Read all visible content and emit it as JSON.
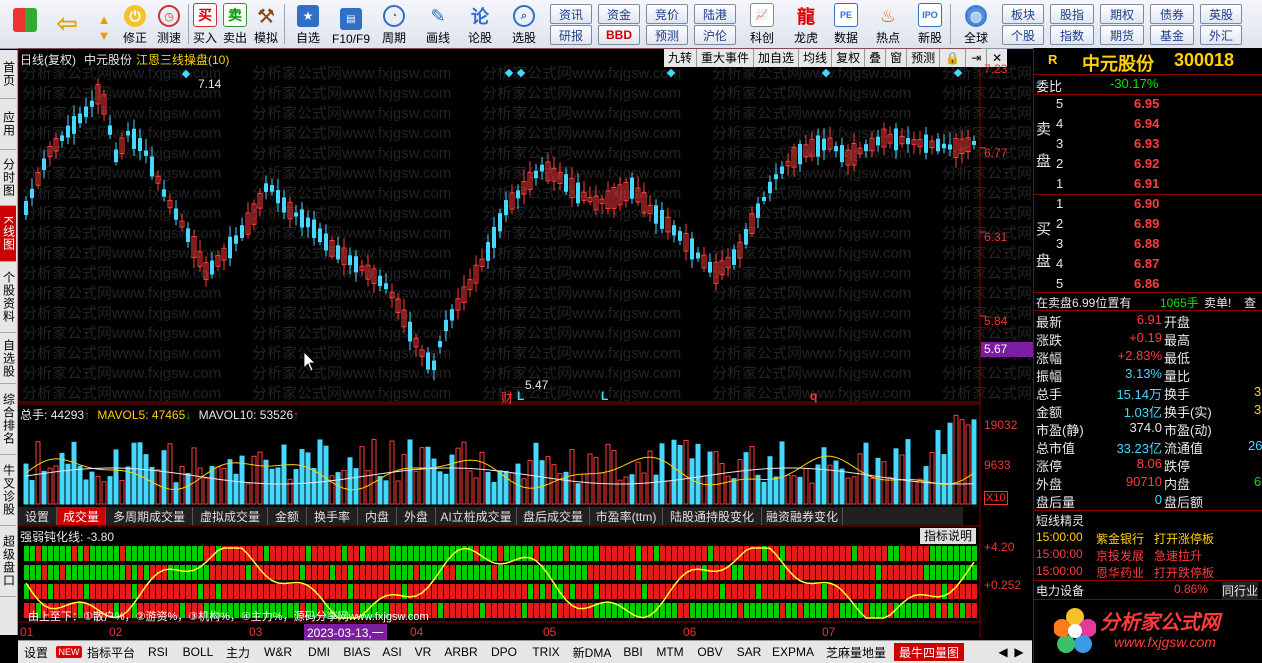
{
  "toolbar": {
    "buttons": [
      "修正",
      "测速",
      "买入",
      "卖出",
      "模拟",
      "自选",
      "F10/F9",
      "周期",
      "画线",
      "论股",
      "选股",
      "科创",
      "龙虎",
      "数据",
      "热点",
      "新股",
      "全球"
    ],
    "quick_top": [
      "资讯",
      "资金",
      "竞价",
      "陆港",
      "板块",
      "股指",
      "期权",
      "债券",
      "英股"
    ],
    "quick_bottom": [
      "研报",
      "BBD",
      "预测",
      "沪伦",
      "个股",
      "指数",
      "期货",
      "基金",
      "外汇"
    ]
  },
  "left_tabs": [
    "首页",
    "应用",
    "分时图",
    "K线图",
    "个股资料",
    "自选股",
    "综合排名",
    "牛叉诊股",
    "超级盘口"
  ],
  "main_chart": {
    "header_left": "日线(复权)",
    "stock_name": "中元股份",
    "indicator_name": "江恩三线操盘(10)",
    "header_buttons": [
      "九转",
      "重大事件",
      "加自选",
      "均线",
      "复权",
      "叠",
      "窗",
      "预测"
    ],
    "y_ticks": [
      "7.23",
      "6.77",
      "6.31",
      "5.84"
    ],
    "current_price_tag": "5.67",
    "high_label": "7.14",
    "low_label": "5.47",
    "markers": [
      "财",
      "L",
      "L",
      "q"
    ],
    "watermark": "分析家公式网www.fxjgsw.com"
  },
  "volume_panel": {
    "label": "总手:",
    "value": "44293",
    "mavol5_label": "MAVOL5:",
    "mavol5": "47465",
    "mavol10_label": "MAVOL10:",
    "mavol10": "53526",
    "y_ticks": [
      "19032",
      "9633"
    ],
    "unit": "X10",
    "tabs": [
      "设置",
      "成交量",
      "多周期成交量",
      "虚拟成交量",
      "金额",
      "换手率",
      "内盘",
      "外盘",
      "AI立桩成交量",
      "盘后成交量",
      "市盈率(ttm)",
      "陆股通持股变化",
      "融资融券变化"
    ]
  },
  "indicator_panel": {
    "label": "强弱钝化线:",
    "value": "-3.80",
    "explain_button": "指标说明",
    "y_ticks": [
      "+4.20",
      "+0.252"
    ],
    "legend_text": "由上至下：①散户%，②游资%，③机构%，④主力%，源码分享网www.fxjgsw.com"
  },
  "x_axis": {
    "months": [
      "01",
      "02",
      "03",
      "04",
      "05",
      "06",
      "07"
    ],
    "cursor_date": "2023-03-13,一"
  },
  "bottom_tabs": [
    "设置",
    "NEW",
    "指标平台",
    "RSI",
    "BOLL",
    "主力",
    "W&R",
    "DMI",
    "BIAS",
    "ASI",
    "VR",
    "ARBR",
    "DPO",
    "TRIX",
    "新DMA",
    "BBI",
    "MTM",
    "OBV",
    "SAR",
    "EXPMA",
    "芝麻量地量",
    "最牛四量图"
  ],
  "quote": {
    "flag": "R",
    "name": "中元股份",
    "code": "300018",
    "weibi_label": "委比",
    "weibi": "-30.17%",
    "sell_label": [
      "卖",
      "盘"
    ],
    "buy_label": [
      "买",
      "盘"
    ],
    "asks": [
      {
        "lvl": "5",
        "price": "6.95"
      },
      {
        "lvl": "4",
        "price": "6.94"
      },
      {
        "lvl": "3",
        "price": "6.93"
      },
      {
        "lvl": "2",
        "price": "6.92"
      },
      {
        "lvl": "1",
        "price": "6.91"
      }
    ],
    "bids": [
      {
        "lvl": "1",
        "price": "6.90"
      },
      {
        "lvl": "2",
        "price": "6.89"
      },
      {
        "lvl": "3",
        "price": "6.88"
      },
      {
        "lvl": "4",
        "price": "6.87"
      },
      {
        "lvl": "5",
        "price": "6.86"
      }
    ],
    "sell_note": "在卖盘6.99位置有",
    "sell_note_qty": "1065手",
    "sell_note_tag": "卖单!",
    "sell_note_more": "查",
    "stats": [
      {
        "l": "最新",
        "v": "6.91",
        "r": "开盘"
      },
      {
        "l": "涨跌",
        "v": "+0.19",
        "r": "最高"
      },
      {
        "l": "涨幅",
        "v": "+2.83%",
        "r": "最低"
      },
      {
        "l": "振幅",
        "v": "3.13%",
        "r": "量比"
      },
      {
        "l": "总手",
        "v": "15.14万",
        "r": "换手"
      },
      {
        "l": "金额",
        "v": "1.03亿",
        "r": "换手(实)"
      },
      {
        "l": "市盈(静)",
        "v": "374.0",
        "r": "市盈(动)"
      },
      {
        "l": "总市值",
        "v": "33.23亿",
        "r": "流通值"
      },
      {
        "l": "涨停",
        "v": "8.06",
        "r": "跌停"
      },
      {
        "l": "外盘",
        "v": "90710",
        "r": "内盘"
      },
      {
        "l": "盘后量",
        "v": "0",
        "r": "盘后额"
      }
    ],
    "stats_right_peek": [
      "3",
      "3",
      "26",
      "6"
    ],
    "news_title": "短线精灵",
    "news": [
      {
        "time": "15:00:00",
        "name": "紫金银行",
        "event": "打开涨停板"
      },
      {
        "time": "15:00:00",
        "name": "京投发展",
        "event": "急速拉升"
      },
      {
        "time": "15:00:00",
        "name": "恩华药业",
        "event": "打开跌停板"
      }
    ],
    "sector": "电力设备",
    "sector_pct": "0.86%",
    "sector_more": "同行业",
    "logo_text": "分析家公式网",
    "logo_url": "www.fxjgsw.com"
  }
}
